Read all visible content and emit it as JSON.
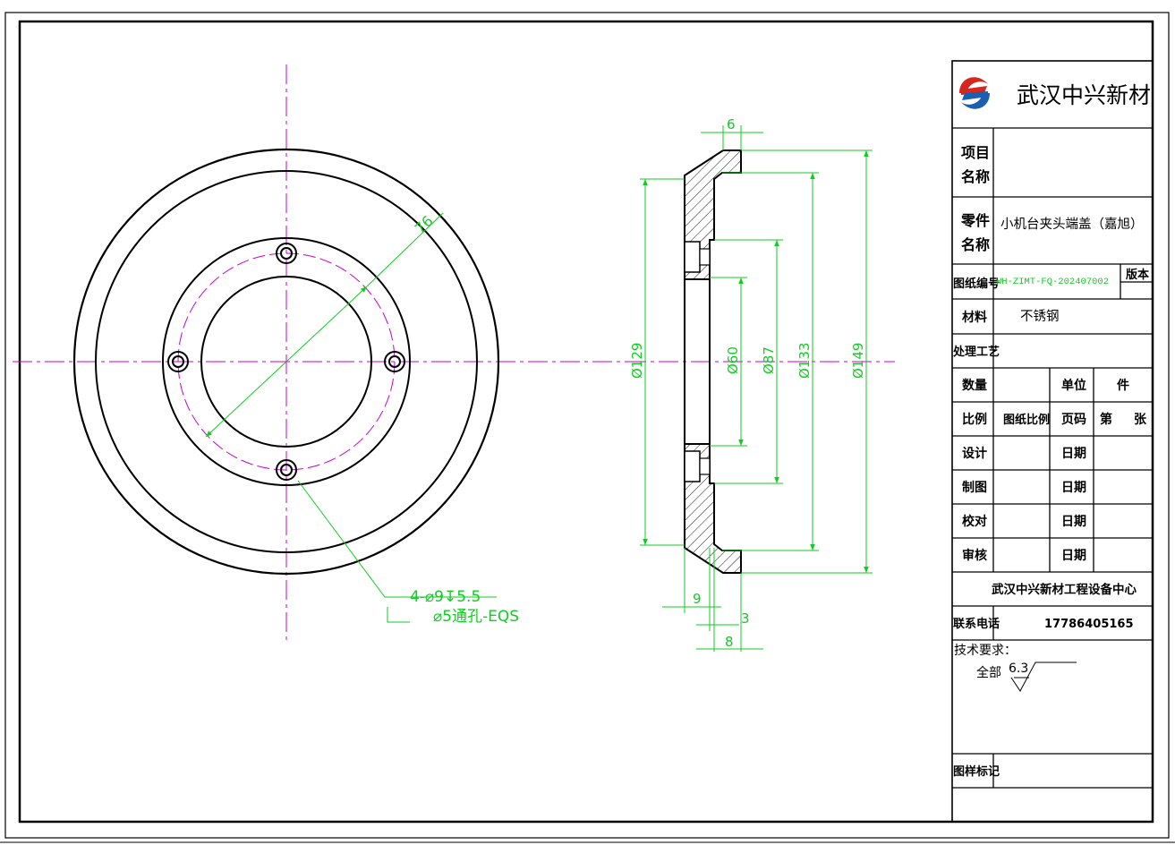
{
  "company": {
    "name": "武汉中兴新材",
    "center": "武汉中兴新材工程设备中心",
    "phone": "17786405165",
    "colors": {
      "logo_red": "#d7261e",
      "logo_blue": "#1c5fb0"
    }
  },
  "title_block": {
    "project_label_1": "项目",
    "project_label_2": "名称",
    "project_value": "",
    "part_label_1": "零件",
    "part_label_2": "名称",
    "part_value": "小机台夹头端盖（嘉旭）",
    "drawing_no_label": "图纸编号",
    "drawing_no_value": "WH-ZIMT-FQ-202407002",
    "version_label": "版本",
    "material_label": "材料",
    "material_value": "不锈钢",
    "process_label": "处理工艺",
    "quantity_label": "数量",
    "unit_label": "单位",
    "unit_value": "件",
    "scale_label": "比例",
    "drawing_scale_label": "图纸比例",
    "page_label": "页码",
    "page_prefix": "第",
    "page_suffix": "张",
    "design_label": "设计",
    "draw_label": "制图",
    "check_label": "校对",
    "review_label": "审核",
    "date_label": "日期",
    "phone_label": "联系电话",
    "tech_label": "技术要求：",
    "roughness_prefix": "全部",
    "roughness_value": "6.3",
    "sample_label": "图样标记"
  },
  "dimensions": {
    "pcd": "76",
    "hole_note_1": "4-⌀9↧5.5",
    "hole_note_2": "⌀5通孔-EQS",
    "d129": "Ø129",
    "d60": "Ø60",
    "d87": "Ø87",
    "d133": "Ø133",
    "d149": "Ø149",
    "w6": "6",
    "w9": "9",
    "w3": "3",
    "w8": "8"
  },
  "colors": {
    "dimension": "#11cc22",
    "centerline": "#cc00cc",
    "outline": "#000000"
  }
}
